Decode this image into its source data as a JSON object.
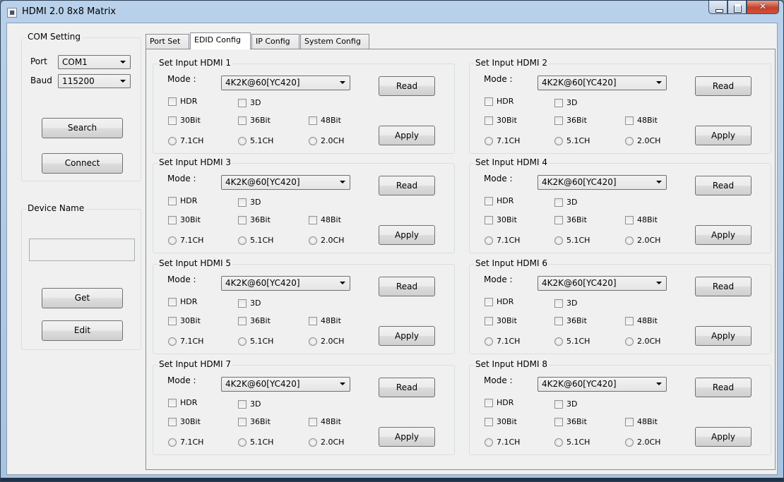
{
  "window": {
    "title": "HDMI 2.0 8x8 Matrix"
  },
  "com": {
    "group_label": "COM Setting",
    "port_label": "Port",
    "port_value": "COM1",
    "baud_label": "Baud",
    "baud_value": "115200",
    "search_label": "Search",
    "connect_label": "Connect"
  },
  "device": {
    "group_label": "Device Name",
    "name_value": "",
    "get_label": "Get",
    "edit_label": "Edit"
  },
  "tabs": [
    {
      "label": "Port Set"
    },
    {
      "label": "EDID Config"
    },
    {
      "label": "IP Config"
    },
    {
      "label": "System Config"
    }
  ],
  "inputs": [
    {
      "title": "Set Input HDMI 1",
      "mode_label": "Mode :",
      "mode_value": "4K2K@60[YC420]",
      "read_label": "Read",
      "apply_label": "Apply",
      "hdr": "HDR",
      "three_d": "3D",
      "bit30": "30Bit",
      "bit36": "36Bit",
      "bit48": "48Bit",
      "ch71": "7.1CH",
      "ch51": "5.1CH",
      "ch20": "2.0CH"
    },
    {
      "title": "Set Input HDMI 2",
      "mode_label": "Mode :",
      "mode_value": "4K2K@60[YC420]",
      "read_label": "Read",
      "apply_label": "Apply",
      "hdr": "HDR",
      "three_d": "3D",
      "bit30": "30Bit",
      "bit36": "36Bit",
      "bit48": "48Bit",
      "ch71": "7.1CH",
      "ch51": "5.1CH",
      "ch20": "2.0CH"
    },
    {
      "title": "Set Input HDMI 3",
      "mode_label": "Mode :",
      "mode_value": "4K2K@60[YC420]",
      "read_label": "Read",
      "apply_label": "Apply",
      "hdr": "HDR",
      "three_d": "3D",
      "bit30": "30Bit",
      "bit36": "36Bit",
      "bit48": "48Bit",
      "ch71": "7.1CH",
      "ch51": "5.1CH",
      "ch20": "2.0CH"
    },
    {
      "title": "Set Input HDMI 4",
      "mode_label": "Mode :",
      "mode_value": "4K2K@60[YC420]",
      "read_label": "Read",
      "apply_label": "Apply",
      "hdr": "HDR",
      "three_d": "3D",
      "bit30": "30Bit",
      "bit36": "36Bit",
      "bit48": "48Bit",
      "ch71": "7.1CH",
      "ch51": "5.1CH",
      "ch20": "2.0CH"
    },
    {
      "title": "Set Input HDMI 5",
      "mode_label": "Mode :",
      "mode_value": "4K2K@60[YC420]",
      "read_label": "Read",
      "apply_label": "Apply",
      "hdr": "HDR",
      "three_d": "3D",
      "bit30": "30Bit",
      "bit36": "36Bit",
      "bit48": "48Bit",
      "ch71": "7.1CH",
      "ch51": "5.1CH",
      "ch20": "2.0CH"
    },
    {
      "title": "Set Input HDMI 6",
      "mode_label": "Mode :",
      "mode_value": "4K2K@60[YC420]",
      "read_label": "Read",
      "apply_label": "Apply",
      "hdr": "HDR",
      "three_d": "3D",
      "bit30": "30Bit",
      "bit36": "36Bit",
      "bit48": "48Bit",
      "ch71": "7.1CH",
      "ch51": "5.1CH",
      "ch20": "2.0CH"
    },
    {
      "title": "Set Input HDMI 7",
      "mode_label": "Mode :",
      "mode_value": "4K2K@60[YC420]",
      "read_label": "Read",
      "apply_label": "Apply",
      "hdr": "HDR",
      "three_d": "3D",
      "bit30": "30Bit",
      "bit36": "36Bit",
      "bit48": "48Bit",
      "ch71": "7.1CH",
      "ch51": "5.1CH",
      "ch20": "2.0CH"
    },
    {
      "title": "Set Input HDMI 8",
      "mode_label": "Mode :",
      "mode_value": "4K2K@60[YC420]",
      "read_label": "Read",
      "apply_label": "Apply",
      "hdr": "HDR",
      "three_d": "3D",
      "bit30": "30Bit",
      "bit36": "36Bit",
      "bit48": "48Bit",
      "ch71": "7.1CH",
      "ch51": "5.1CH",
      "ch20": "2.0CH"
    }
  ]
}
